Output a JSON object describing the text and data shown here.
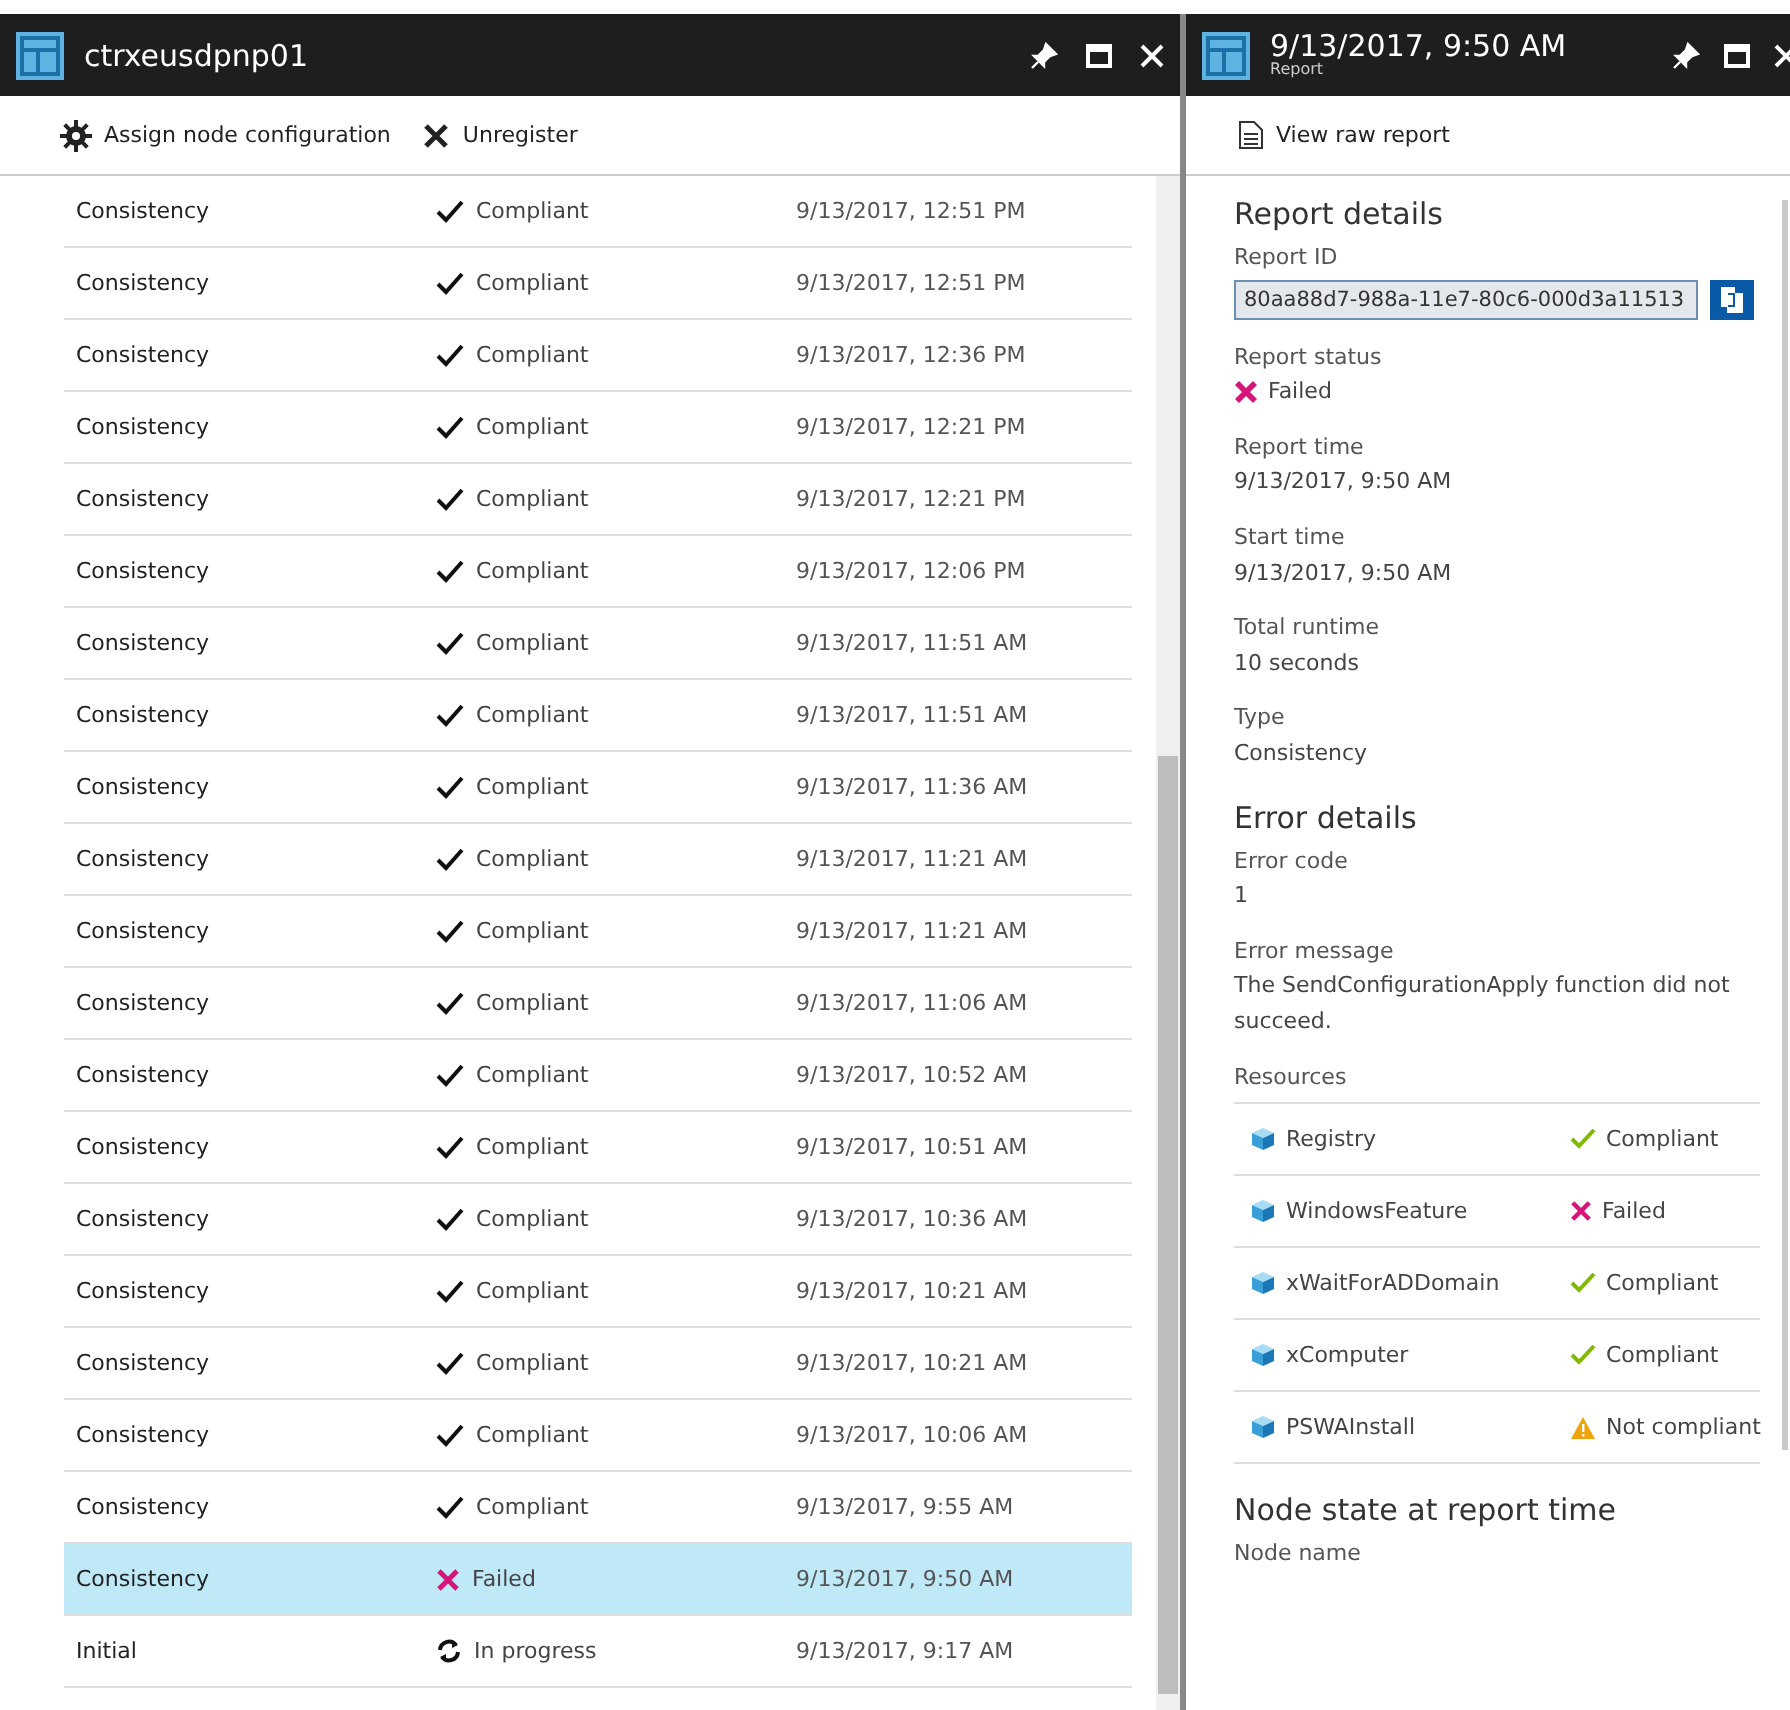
{
  "left_blade": {
    "title": "ctrxeusdpnp01",
    "toolbar": [
      {
        "label": "Assign node configuration",
        "kind": "gear"
      },
      {
        "label": "Unregister",
        "kind": "x"
      }
    ],
    "rows": [
      {
        "type": "Consistency",
        "status": "Compliant",
        "kind": "compliant",
        "time": "9/13/2017, 12:51 PM",
        "selected": false
      },
      {
        "type": "Consistency",
        "status": "Compliant",
        "kind": "compliant",
        "time": "9/13/2017, 12:51 PM",
        "selected": false
      },
      {
        "type": "Consistency",
        "status": "Compliant",
        "kind": "compliant",
        "time": "9/13/2017, 12:36 PM",
        "selected": false
      },
      {
        "type": "Consistency",
        "status": "Compliant",
        "kind": "compliant",
        "time": "9/13/2017, 12:21 PM",
        "selected": false
      },
      {
        "type": "Consistency",
        "status": "Compliant",
        "kind": "compliant",
        "time": "9/13/2017, 12:21 PM",
        "selected": false
      },
      {
        "type": "Consistency",
        "status": "Compliant",
        "kind": "compliant",
        "time": "9/13/2017, 12:06 PM",
        "selected": false
      },
      {
        "type": "Consistency",
        "status": "Compliant",
        "kind": "compliant",
        "time": "9/13/2017, 11:51 AM",
        "selected": false
      },
      {
        "type": "Consistency",
        "status": "Compliant",
        "kind": "compliant",
        "time": "9/13/2017, 11:51 AM",
        "selected": false
      },
      {
        "type": "Consistency",
        "status": "Compliant",
        "kind": "compliant",
        "time": "9/13/2017, 11:36 AM",
        "selected": false
      },
      {
        "type": "Consistency",
        "status": "Compliant",
        "kind": "compliant",
        "time": "9/13/2017, 11:21 AM",
        "selected": false
      },
      {
        "type": "Consistency",
        "status": "Compliant",
        "kind": "compliant",
        "time": "9/13/2017, 11:21 AM",
        "selected": false
      },
      {
        "type": "Consistency",
        "status": "Compliant",
        "kind": "compliant",
        "time": "9/13/2017, 11:06 AM",
        "selected": false
      },
      {
        "type": "Consistency",
        "status": "Compliant",
        "kind": "compliant",
        "time": "9/13/2017, 10:52 AM",
        "selected": false
      },
      {
        "type": "Consistency",
        "status": "Compliant",
        "kind": "compliant",
        "time": "9/13/2017, 10:51 AM",
        "selected": false
      },
      {
        "type": "Consistency",
        "status": "Compliant",
        "kind": "compliant",
        "time": "9/13/2017, 10:36 AM",
        "selected": false
      },
      {
        "type": "Consistency",
        "status": "Compliant",
        "kind": "compliant",
        "time": "9/13/2017, 10:21 AM",
        "selected": false
      },
      {
        "type": "Consistency",
        "status": "Compliant",
        "kind": "compliant",
        "time": "9/13/2017, 10:21 AM",
        "selected": false
      },
      {
        "type": "Consistency",
        "status": "Compliant",
        "kind": "compliant",
        "time": "9/13/2017, 10:06 AM",
        "selected": false
      },
      {
        "type": "Consistency",
        "status": "Compliant",
        "kind": "compliant",
        "time": "9/13/2017, 9:55 AM",
        "selected": false
      },
      {
        "type": "Consistency",
        "status": "Failed",
        "kind": "failed",
        "time": "9/13/2017, 9:50 AM",
        "selected": true
      },
      {
        "type": "Initial",
        "status": "In progress",
        "kind": "in_progress",
        "time": "9/13/2017, 9:17 AM",
        "selected": false
      }
    ]
  },
  "right_blade": {
    "title": "9/13/2017, 9:50 AM",
    "subtitle": "Report",
    "toolbar": [
      {
        "label": "View raw report",
        "kind": "document"
      }
    ],
    "report_heading": "Report details",
    "report_id_label": "Report ID",
    "report_id": "80aa88d7-988a-11e7-80c6-000d3a11513",
    "status_label": "Report status",
    "status": {
      "label": "Failed",
      "kind": "failed"
    },
    "fields": [
      {
        "label": "Report time",
        "value": "9/13/2017, 9:50 AM"
      },
      {
        "label": "Start time",
        "value": "9/13/2017, 9:50 AM"
      },
      {
        "label": "Total runtime",
        "value": "10 seconds"
      },
      {
        "label": "Type",
        "value": "Consistency"
      }
    ],
    "error_heading": "Error details",
    "error_fields": [
      {
        "label": "Error code",
        "value": "1"
      },
      {
        "label": "Error message",
        "value": "The SendConfigurationApply function did not succeed."
      }
    ],
    "resources_label": "Resources",
    "resources": [
      {
        "name": "Registry",
        "status": "Compliant",
        "kind": "compliant"
      },
      {
        "name": "WindowsFeature",
        "status": "Failed",
        "kind": "failed"
      },
      {
        "name": "xWaitForADDomain",
        "status": "Compliant",
        "kind": "compliant"
      },
      {
        "name": "xComputer",
        "status": "Compliant",
        "kind": "compliant"
      },
      {
        "name": "PSWAInstall",
        "status": "Not compliant",
        "kind": "not_compliant"
      }
    ],
    "node_heading": "Node state at report time",
    "node_name_label": "Node name"
  }
}
